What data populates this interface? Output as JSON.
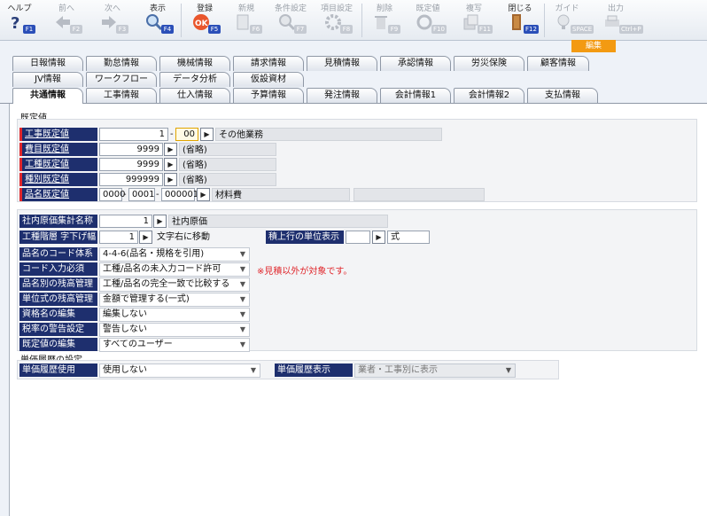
{
  "toolbar": {
    "items": [
      {
        "label": "ヘルプ",
        "key": "F1",
        "icon": "help-icon",
        "enabled": true
      },
      {
        "label": "前へ",
        "key": "F2",
        "icon": "arrow-left-icon",
        "enabled": false
      },
      {
        "label": "次へ",
        "key": "F3",
        "icon": "arrow-right-icon",
        "enabled": false
      },
      {
        "label": "表示",
        "key": "F4",
        "icon": "magnifier-icon",
        "enabled": true
      },
      {
        "label": "登録",
        "key": "F5",
        "icon": "ok-icon",
        "enabled": true
      },
      {
        "label": "新規",
        "key": "F6",
        "icon": "new-icon",
        "enabled": false
      },
      {
        "label": "条件設定",
        "key": "F7",
        "icon": "search-settings-icon",
        "enabled": false
      },
      {
        "label": "項目設定",
        "key": "F8",
        "icon": "item-settings-icon",
        "enabled": false
      },
      {
        "label": "削除",
        "key": "F9",
        "icon": "trash-icon",
        "enabled": false
      },
      {
        "label": "既定値",
        "key": "F10",
        "icon": "refresh-icon",
        "enabled": false
      },
      {
        "label": "複写",
        "key": "F11",
        "icon": "copy-icon",
        "enabled": false
      },
      {
        "label": "閉じる",
        "key": "F12",
        "icon": "close-door-icon",
        "enabled": true
      },
      {
        "label": "ガイド",
        "key": "SPACE",
        "icon": "guide-icon",
        "enabled": false
      },
      {
        "label": "出力",
        "key": "Ctrl+P",
        "icon": "print-icon",
        "enabled": false
      }
    ],
    "mode_badge": "編集"
  },
  "tabs": {
    "row1": [
      "日報情報",
      "勤怠情報",
      "機械情報",
      "請求情報",
      "見積情報",
      "承認情報",
      "労災保険",
      "顧客情報"
    ],
    "row2": [
      "JV情報",
      "ワークフロー",
      "データ分析",
      "仮設資材"
    ],
    "row3": [
      "共通情報",
      "工事情報",
      "仕入情報",
      "予算情報",
      "発注情報",
      "会計情報1",
      "会計情報2",
      "支払情報"
    ],
    "active": "共通情報"
  },
  "defaults": {
    "title": "既定値",
    "koji": {
      "label": "工事既定値",
      "code1": "1",
      "sep": "-",
      "code2": "00",
      "name": "その他業務"
    },
    "hiyo": {
      "label": "費目既定値",
      "code": "9999",
      "name": "(省略)"
    },
    "koshu": {
      "label": "工種既定値",
      "code": "9999",
      "name": "(省略)"
    },
    "shubetsu": {
      "label": "種別既定値",
      "code": "999999",
      "name": "(省略)"
    },
    "hinmei": {
      "label": "品名既定値",
      "code1": "0000",
      "code2": "0001",
      "code3": "000001",
      "name": "材料費"
    }
  },
  "settings": {
    "genka": {
      "label": "社内原価集計名称",
      "code": "1",
      "name": "社内原価"
    },
    "kaiso": {
      "label": "工種階層 字下げ幅",
      "code": "1",
      "after": "文字右に移動"
    },
    "tani": {
      "label": "積上行の単位表示",
      "value": "式"
    },
    "rows": [
      {
        "label": "品名のコード体系",
        "value": "4-4-6(品名・規格を引用)"
      },
      {
        "label": "コード入力必須",
        "value": "工種/品名の未入力コード許可"
      },
      {
        "label": "品名別の残高管理",
        "value": "工種/品名の完全一致で比較する"
      },
      {
        "label": "単位式の残高管理",
        "value": "金額で管理する(一式)"
      },
      {
        "label": "資格名の編集",
        "value": "編集しない"
      },
      {
        "label": "税率の警告設定",
        "value": "警告しない"
      },
      {
        "label": "既定値の編集",
        "value": "すべてのユーザー"
      }
    ],
    "note": "※見積以外が対象です。"
  },
  "history": {
    "title": "単価履歴の設定",
    "use": {
      "label": "単価履歴使用",
      "value": "使用しない"
    },
    "display": {
      "label": "単価履歴表示",
      "value": "業者・工事別に表示"
    }
  }
}
